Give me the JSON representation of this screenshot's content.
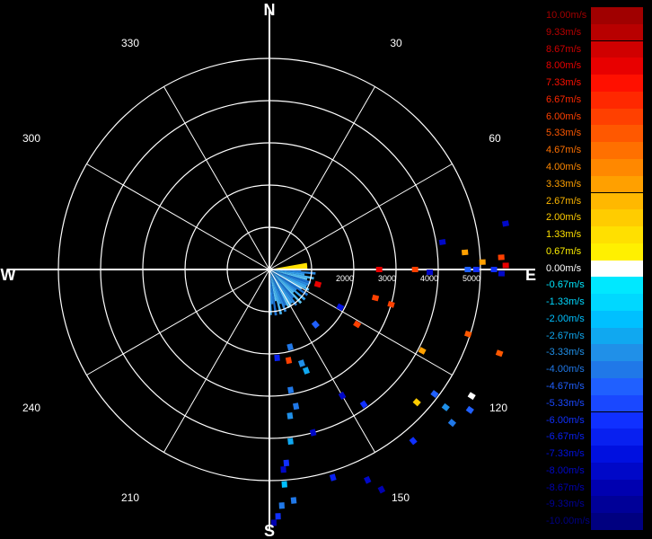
{
  "chart_data": {
    "type": "polar-scatter",
    "compass": {
      "north": "N",
      "east": "E",
      "south": "S",
      "west": "W"
    },
    "bearing_labels": [
      "30",
      "60",
      "120",
      "150",
      "210",
      "240",
      "300",
      "330"
    ],
    "range_rings": [
      1000,
      2000,
      3000,
      4000,
      5000
    ],
    "range_labels": [
      "2000",
      "3000",
      "4000",
      "5000"
    ],
    "rmax": 5000,
    "colorbar": {
      "labels": [
        "10.00m/s",
        "9.33m/s",
        "8.67m/s",
        "8.00m/s",
        "7.33m/s",
        "6.67m/s",
        "6.00m/s",
        "5.33m/s",
        "4.67m/s",
        "4.00m/s",
        "3.33m/s",
        "2.67m/s",
        "2.00m/s",
        "1.33m/s",
        "0.67m/s",
        "0.00m/s",
        "-0.67m/s",
        "-1.33m/s",
        "-2.00m/s",
        "-2.67m/s",
        "-3.33m/s",
        "-4.00m/s",
        "-4.67m/s",
        "-5.33m/s",
        "-6.00m/s",
        "-6.67m/s",
        "-7.33m/s",
        "-8.00m/s",
        "-8.67m/s",
        "-9.33m/s",
        "-10.00m/s"
      ],
      "colors": [
        "#a00000",
        "#b80000",
        "#d00000",
        "#e80000",
        "#ff1000",
        "#ff2800",
        "#ff4000",
        "#ff5800",
        "#ff7000",
        "#ff8800",
        "#ffa000",
        "#ffb800",
        "#ffcc00",
        "#ffe000",
        "#fff000",
        "#ffffff",
        "#00e8ff",
        "#00d8ff",
        "#00c0ff",
        "#10a8f0",
        "#2090e8",
        "#2078e8",
        "#2060ff",
        "#1a48ff",
        "#1030ff",
        "#0820f0",
        "#0010e0",
        "#0008c8",
        "#0000b0",
        "#000098",
        "#000080"
      ]
    },
    "near_field_sector": {
      "from_deg": 90,
      "to_deg": 180,
      "max_range": 1000,
      "note": "dense negative velocity returns"
    },
    "points": [
      {
        "az": 81,
        "r": 4150,
        "v": -8.0
      },
      {
        "az": 85,
        "r": 4650,
        "v": 3.3
      },
      {
        "az": 79,
        "r": 5700,
        "v": -8.0
      },
      {
        "az": 87,
        "r": 5500,
        "v": 6.0
      },
      {
        "az": 88,
        "r": 5050,
        "v": 3.3
      },
      {
        "az": 90,
        "r": 5320,
        "v": -6.0
      },
      {
        "az": 89,
        "r": 5600,
        "v": 8.0
      },
      {
        "az": 91,
        "r": 5500,
        "v": -8.0
      },
      {
        "az": 90,
        "r": 2600,
        "v": 8.0
      },
      {
        "az": 90,
        "r": 3450,
        "v": 6.0
      },
      {
        "az": 91,
        "r": 3800,
        "v": -8.0
      },
      {
        "az": 90,
        "r": 4900,
        "v": -6.0
      },
      {
        "az": 90,
        "r": 4700,
        "v": -4.7
      },
      {
        "az": 105,
        "r": 2600,
        "v": 6.0
      },
      {
        "az": 106,
        "r": 3000,
        "v": 6.0
      },
      {
        "az": 108,
        "r": 4950,
        "v": 5.3
      },
      {
        "az": 110,
        "r": 5800,
        "v": 5.3
      },
      {
        "az": 118,
        "r": 4100,
        "v": 3.3
      },
      {
        "az": 127,
        "r": 4900,
        "v": -4.7
      },
      {
        "az": 128,
        "r": 5300,
        "v": -3.3
      },
      {
        "az": 132,
        "r": 4700,
        "v": 2.0
      },
      {
        "az": 130,
        "r": 5650,
        "v": -4.0
      },
      {
        "az": 122,
        "r": 5650,
        "v": 0.0
      },
      {
        "az": 140,
        "r": 5300,
        "v": -6.0
      },
      {
        "az": 125,
        "r": 5800,
        "v": -4.7
      },
      {
        "az": 155,
        "r": 5500,
        "v": -8.0
      },
      {
        "az": 153,
        "r": 5850,
        "v": -8.7
      },
      {
        "az": 163,
        "r": 5150,
        "v": -6.7
      },
      {
        "az": 165,
        "r": 4000,
        "v": -8.0
      },
      {
        "az": 169,
        "r": 3300,
        "v": -4.0
      },
      {
        "az": 170,
        "r": 2900,
        "v": -4.0
      },
      {
        "az": 172,
        "r": 3500,
        "v": -3.3
      },
      {
        "az": 173,
        "r": 4100,
        "v": -2.7
      },
      {
        "az": 175,
        "r": 4600,
        "v": -6.0
      },
      {
        "az": 176,
        "r": 4750,
        "v": -8.0
      },
      {
        "az": 176,
        "r": 5100,
        "v": -2.0
      },
      {
        "az": 177,
        "r": 5600,
        "v": -4.0
      },
      {
        "az": 178,
        "r": 5850,
        "v": -6.0
      },
      {
        "az": 179,
        "r": 6000,
        "v": -8.7
      },
      {
        "az": 174,
        "r": 5500,
        "v": -4.0
      },
      {
        "az": 175,
        "r": 2100,
        "v": -6.7
      },
      {
        "az": 168,
        "r": 2200,
        "v": 6.0
      },
      {
        "az": 165,
        "r": 1900,
        "v": -4.0
      },
      {
        "az": 161,
        "r": 2350,
        "v": -3.3
      },
      {
        "az": 160,
        "r": 2550,
        "v": -2.7
      },
      {
        "az": 150,
        "r": 3450,
        "v": -8.0
      },
      {
        "az": 145,
        "r": 3900,
        "v": -6.0
      },
      {
        "az": 140,
        "r": 1700,
        "v": -4.7
      },
      {
        "az": 118,
        "r": 1900,
        "v": -7.3
      },
      {
        "az": 122,
        "r": 2450,
        "v": 6.0
      },
      {
        "az": 107,
        "r": 1200,
        "v": 8.0
      }
    ]
  }
}
